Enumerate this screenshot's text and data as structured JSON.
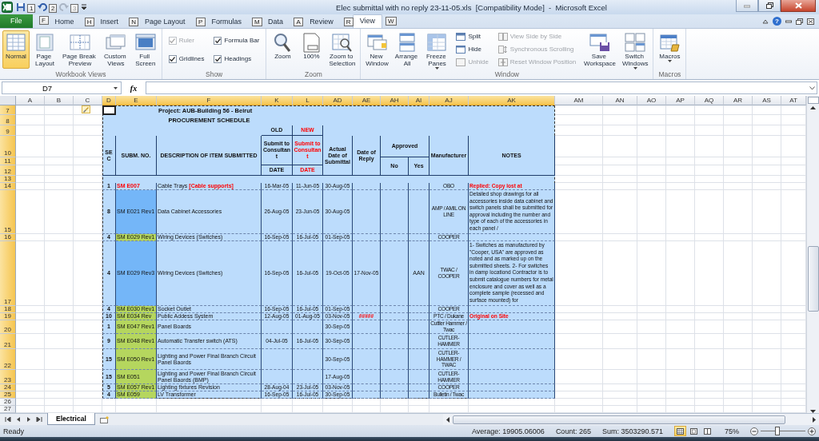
{
  "window": {
    "title": "Elec submittal with no reply 23-11-05.xls  [Compatibility Mode]  -  Microsoft Excel",
    "help": "?"
  },
  "quick_access": [
    {
      "keytip": "1",
      "disabled": false
    },
    {
      "keytip": "2",
      "disabled": false
    },
    {
      "keytip": "3",
      "disabled": true
    }
  ],
  "ribbon": {
    "tabs": [
      {
        "label": "File",
        "keytip": "F",
        "kind": "file",
        "selected": false
      },
      {
        "label": "Home",
        "keytip": "H",
        "kind": "tab",
        "selected": false
      },
      {
        "label": "Insert",
        "keytip": "N",
        "kind": "tab",
        "selected": false
      },
      {
        "label": "Page Layout",
        "keytip": "P",
        "kind": "tab",
        "selected": false
      },
      {
        "label": "Formulas",
        "keytip": "M",
        "kind": "tab",
        "selected": false
      },
      {
        "label": "Data",
        "keytip": "A",
        "kind": "tab",
        "selected": false
      },
      {
        "label": "Review",
        "keytip": "R",
        "kind": "tab",
        "selected": false
      },
      {
        "label": "View",
        "keytip": "W",
        "kind": "tab",
        "selected": true
      }
    ],
    "groups": [
      {
        "label": "Workbook Views",
        "items": [
          {
            "label": "Normal",
            "kind": "large",
            "selected": true
          },
          {
            "label": "Page Layout",
            "kind": "large",
            "selected": false
          },
          {
            "label": "Page Break Preview",
            "kind": "large",
            "selected": false
          },
          {
            "label": "Custom Views",
            "kind": "large",
            "selected": false
          },
          {
            "label": "Full Screen",
            "kind": "large",
            "selected": false
          }
        ]
      },
      {
        "label": "Show",
        "items": [
          {
            "label": "Ruler",
            "kind": "check",
            "checked": true,
            "disabled": true
          },
          {
            "label": "Gridlines",
            "kind": "check",
            "checked": true,
            "disabled": false
          },
          {
            "label": "Formula Bar",
            "kind": "check",
            "checked": true,
            "disabled": false
          },
          {
            "label": "Headings",
            "kind": "check",
            "checked": true,
            "disabled": false
          }
        ]
      },
      {
        "label": "Zoom",
        "items": [
          {
            "label": "Zoom",
            "kind": "large"
          },
          {
            "label": "100%",
            "kind": "large"
          },
          {
            "label": "Zoom to Selection",
            "kind": "large"
          }
        ]
      },
      {
        "label": "Window",
        "items": [
          {
            "label": "New Window",
            "kind": "large"
          },
          {
            "label": "Arrange All",
            "kind": "large"
          },
          {
            "label": "Freeze Panes",
            "kind": "large",
            "dropdown": true
          },
          {
            "label": "Split",
            "kind": "small",
            "disabled": false
          },
          {
            "label": "Hide",
            "kind": "small",
            "disabled": false
          },
          {
            "label": "Unhide",
            "kind": "small",
            "disabled": true
          },
          {
            "label": "View Side by Side",
            "kind": "small",
            "disabled": true
          },
          {
            "label": "Synchronous Scrolling",
            "kind": "small",
            "disabled": true
          },
          {
            "label": "Reset Window Position",
            "kind": "small",
            "disabled": true
          },
          {
            "label": "Save Workspace",
            "kind": "large"
          },
          {
            "label": "Switch Windows",
            "kind": "large",
            "dropdown": true
          }
        ]
      },
      {
        "label": "Macros",
        "items": [
          {
            "label": "Macros",
            "kind": "large",
            "dropdown": true
          }
        ]
      }
    ]
  },
  "formula_bar": {
    "name_box": "D7",
    "function_label": "fx"
  },
  "sheet": {
    "columns": [
      {
        "label": "A",
        "selected": false
      },
      {
        "label": "B",
        "selected": false
      },
      {
        "label": "C",
        "selected": false
      },
      {
        "label": "D",
        "selected": true
      },
      {
        "label": "E",
        "selected": true
      },
      {
        "label": "F",
        "selected": true
      },
      {
        "label": "K",
        "selected": true
      },
      {
        "label": "L",
        "selected": true
      },
      {
        "label": "AD",
        "selected": true
      },
      {
        "label": "AE",
        "selected": true
      },
      {
        "label": "AH",
        "selected": true
      },
      {
        "label": "AI",
        "selected": true
      },
      {
        "label": "AJ",
        "selected": true
      },
      {
        "label": "AK",
        "selected": true
      },
      {
        "label": "AM",
        "selected": false
      },
      {
        "label": "AN",
        "selected": false
      },
      {
        "label": "AO",
        "selected": false
      },
      {
        "label": "AP",
        "selected": false
      },
      {
        "label": "AQ",
        "selected": false
      },
      {
        "label": "AR",
        "selected": false
      },
      {
        "label": "AS",
        "selected": false
      },
      {
        "label": "AT",
        "selected": false
      }
    ],
    "row_numbers": [
      {
        "label": "7",
        "selected": true
      },
      {
        "label": "8",
        "selected": true
      },
      {
        "label": "9",
        "selected": true
      },
      {
        "label": "10",
        "selected": true
      },
      {
        "label": "11",
        "selected": true
      },
      {
        "label": "12",
        "selected": true
      },
      {
        "label": "13",
        "selected": true
      },
      {
        "label": "14",
        "selected": true
      },
      {
        "label": "15",
        "selected": true
      },
      {
        "label": "16",
        "selected": true
      },
      {
        "label": "17",
        "selected": true
      },
      {
        "label": "18",
        "selected": true
      },
      {
        "label": "19",
        "selected": true
      },
      {
        "label": "20",
        "selected": true
      },
      {
        "label": "21",
        "selected": true
      },
      {
        "label": "22",
        "selected": true
      },
      {
        "label": "23",
        "selected": true
      },
      {
        "label": "24",
        "selected": true
      },
      {
        "label": "25",
        "selected": true
      },
      {
        "label": "26",
        "selected": false
      },
      {
        "label": "27",
        "selected": false
      }
    ],
    "header": {
      "title": "Project: AUB-Building 56 - Beirut",
      "subtitle": "PROCUREMENT SCHEDULE",
      "old": "OLD",
      "new": "NEW",
      "sec": "SEC",
      "submission": "SUBM. NO.",
      "description": "DESCRIPTION OF ITEM SUBMITTED",
      "submit_old": "Submit to Consultant",
      "submit_new": "Submit to Consultant",
      "date_old": "DATE",
      "date_new": "DATE",
      "actual_date": "Actual Date of Submittal",
      "reply_date": "Date of Reply",
      "approved": "Approved",
      "no": "No",
      "yes": "Yes",
      "manufacturer": "Manufacturer",
      "notes": "NOTES"
    },
    "rows": [
      {
        "sec": "1",
        "submission": {
          "text": "SM E007",
          "kind": "text",
          "color": "#ff0000"
        },
        "description": "Cable Trays **[Cable supports]**",
        "old_date": "16-Mar-05",
        "new_date": "11-Jun-05",
        "actual_date": "30-Aug-05",
        "manufacturer": "OBO",
        "notes": {
          "text": "Replied: Copy lost at",
          "kind": "alert"
        }
      },
      {
        "sec": "8",
        "submission": {
          "text": "SM E021 Rev1",
          "kind": "fill",
          "color": "#74b6f8"
        },
        "description": "Data Cabinet Accessories",
        "old_date": "26-Aug-05",
        "new_date": "23-Jun-05",
        "actual_date": "30-Aug-05",
        "manufacturer": "AMP / AMIL ON LINE",
        "notes": "Detailed shop drawings for all accessories inside data cabinet and switch panels shall be submitted for approval including the number and type of each of the accessories in each panel /"
      },
      {
        "sec": "4",
        "submission": {
          "text": "SM E029 Rev1",
          "kind": "fill",
          "color": "#b5d65e"
        },
        "description": "Wiring Devices (Switches)",
        "old_date": "16-Sep-05",
        "new_date": "16-Jul-05",
        "actual_date": "01-Sep-05",
        "manufacturer": "COOPER"
      },
      {
        "sec": "4",
        "submission": {
          "text": "SM E029 Rev3",
          "kind": "fill",
          "color": "#74b6f8"
        },
        "description": "Wiring Devices (Switches)",
        "old_date": "16-Sep-05",
        "new_date": "16-Jul-05",
        "actual_date": "19-Oct-05",
        "reply_date": "17-Nov-05",
        "approved_yes": "AAN",
        "manufacturer": "TWAC / COOPER",
        "notes": "1- Switches as manufactured by \"Cooper, USA\" are approved as noted and as marked up on the submitted sheets. 2- For switches in damp locationd Contractor is to submit catalogue numbers for metal enclosure and cover as well as a complete sample (recessed and surface mounted) for"
      },
      {
        "sec": "4",
        "submission": {
          "text": "SM E030 Rev1",
          "kind": "fill",
          "color": "#b5d65e"
        },
        "description": "Socket Outlet",
        "old_date": "16-Sep-05",
        "new_date": "16-Jul-05",
        "actual_date": "01-Sep-05",
        "manufacturer": "COOPER"
      },
      {
        "sec": "10",
        "submission": {
          "text": "SM E034 Rev",
          "kind": "fill",
          "color": "#b5d65e"
        },
        "description": "Public Addess System",
        "old_date": "12-Aug-05",
        "new_date": "01-Aug-05",
        "actual_date": "03-Nov-05",
        "reply_date": {
          "text": "#####",
          "kind": "alert"
        },
        "manufacturer": "PTC / Dukane",
        "notes": {
          "text": "Original on Site",
          "kind": "alert"
        }
      },
      {
        "sec": "1",
        "submission": {
          "text": "SM E047 Rev1",
          "kind": "fill",
          "color": "#b5d65e"
        },
        "description": "Panel Boards",
        "actual_date": "30-Sep-05",
        "manufacturer": "Cuttler Hammer / Twac"
      },
      {
        "sec": "9",
        "submission": {
          "text": "SM E048 Rev1",
          "kind": "fill",
          "color": "#b5d65e"
        },
        "description": "Automatic Transfer switch (ATS)",
        "old_date": "04-Jul-05",
        "new_date": "16-Jul-05",
        "actual_date": "30-Sep-05",
        "manufacturer": "CUTLER-HAMMER"
      },
      {
        "sec": "15",
        "submission": {
          "text": "SM E050 Rev1",
          "kind": "fill",
          "color": "#b5d65e"
        },
        "description": "Lighting and Power Final Branch Circuit Panel Baords",
        "actual_date": "30-Sep-05",
        "manufacturer": "CUTLER-HAMMER / TWAC"
      },
      {
        "sec": "15",
        "submission": {
          "text": "SM E051",
          "kind": "fill",
          "color": "#b5d65e"
        },
        "description": "Lighting and Power Final Branch Circuit Panel Baords (BMP)",
        "actual_date": "17-Aug-05",
        "manufacturer": "CUTLER-HAMMER"
      },
      {
        "sec": "5",
        "submission": {
          "text": "SM E057 Rev1",
          "kind": "fill",
          "color": "#b5d65e"
        },
        "description": "Lighting fixtures  Revision",
        "old_date": "28-Aug-04",
        "new_date": "23-Jul-05",
        "actual_date": "03-Nov-05",
        "manufacturer": "COOPER"
      },
      {
        "sec": "4",
        "submission": {
          "text": "SM E059",
          "kind": "fill",
          "color": "#b5d65e"
        },
        "description": "LV Transformer",
        "old_date": "16-Sep-05",
        "new_date": "16-Jul-05",
        "actual_date": "30-Sep-05",
        "manufacturer": "Bulletin / Twac"
      }
    ]
  },
  "sheet_tabs": [
    {
      "label": "Electrical",
      "selected": true
    }
  ],
  "status_bar": {
    "mode": "Ready",
    "average": "Average: 19905.06006",
    "count": "Count: 265",
    "sum": "Sum: 3503290.571",
    "views": [
      {
        "selected": true
      },
      {
        "selected": false
      },
      {
        "selected": false
      }
    ],
    "zoom": {
      "label": "75%",
      "level": 0.38
    }
  }
}
